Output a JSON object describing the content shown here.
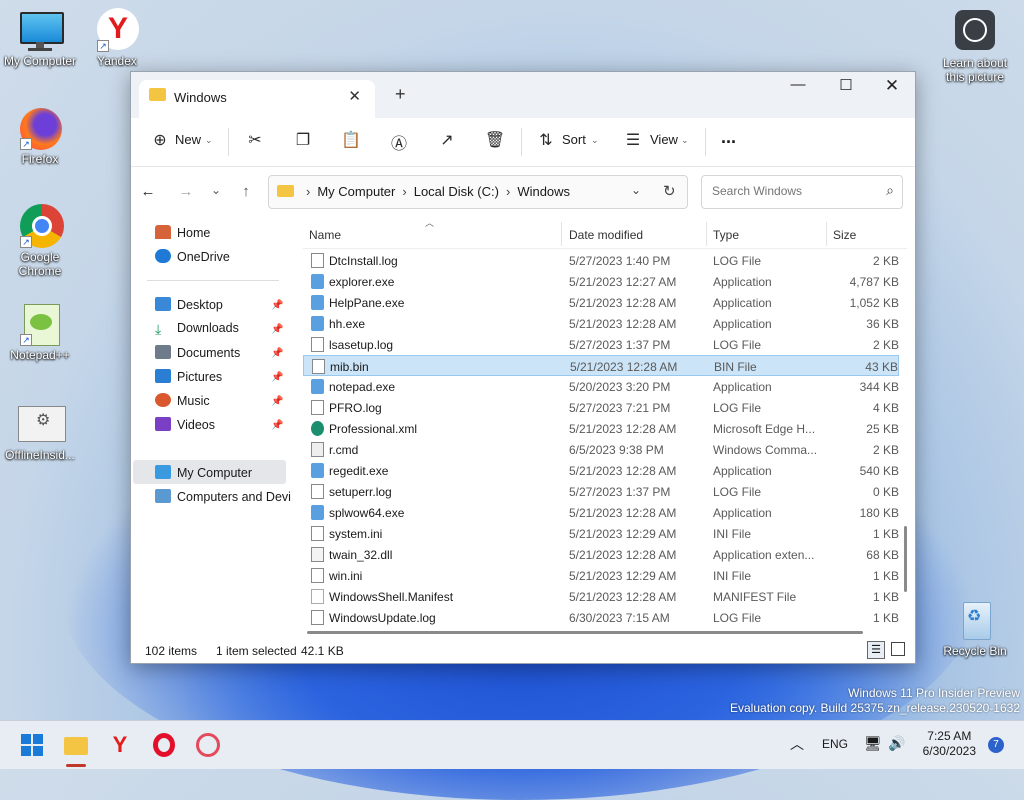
{
  "desktop": {
    "icons": [
      {
        "label": "My Computer"
      },
      {
        "label": "Yandex"
      },
      {
        "label": "Firefox"
      },
      {
        "label": "Google Chrome"
      },
      {
        "label": "Notepad++"
      },
      {
        "label": "OfflineInsid..."
      },
      {
        "label": "Learn about this picture"
      },
      {
        "label": "Recycle Bin"
      }
    ],
    "watermark_line1": "Windows 11 Pro Insider Preview",
    "watermark_line2": "Evaluation copy. Build 25375.zn_release.230520-1632"
  },
  "window": {
    "tab_title": "Windows",
    "toolbar": {
      "new_label": "New",
      "sort_label": "Sort",
      "view_label": "View",
      "more_label": "..."
    },
    "breadcrumb": [
      "My Computer",
      "Local Disk (C:)",
      "Windows"
    ],
    "search_placeholder": "Search Windows",
    "nav": {
      "home": "Home",
      "onedrive": "OneDrive",
      "desktop": "Desktop",
      "downloads": "Downloads",
      "documents": "Documents",
      "pictures": "Pictures",
      "music": "Music",
      "videos": "Videos",
      "mycomputer": "My Computer",
      "computers": "Computers and Devi"
    },
    "columns": {
      "name": "Name",
      "date": "Date modified",
      "type": "Type",
      "size": "Size"
    },
    "files": [
      {
        "name": "DtcInstall.log",
        "date": "5/27/2023 1:40 PM",
        "type": "LOG File",
        "size": "2 KB"
      },
      {
        "name": "explorer.exe",
        "date": "5/21/2023 12:27 AM",
        "type": "Application",
        "size": "4,787 KB"
      },
      {
        "name": "HelpPane.exe",
        "date": "5/21/2023 12:28 AM",
        "type": "Application",
        "size": "1,052 KB"
      },
      {
        "name": "hh.exe",
        "date": "5/21/2023 12:28 AM",
        "type": "Application",
        "size": "36 KB"
      },
      {
        "name": "lsasetup.log",
        "date": "5/27/2023 1:37 PM",
        "type": "LOG File",
        "size": "2 KB"
      },
      {
        "name": "mib.bin",
        "date": "5/21/2023 12:28 AM",
        "type": "BIN File",
        "size": "43 KB"
      },
      {
        "name": "notepad.exe",
        "date": "5/20/2023 3:20 PM",
        "type": "Application",
        "size": "344 KB"
      },
      {
        "name": "PFRO.log",
        "date": "5/27/2023 7:21 PM",
        "type": "LOG File",
        "size": "4 KB"
      },
      {
        "name": "Professional.xml",
        "date": "5/21/2023 12:28 AM",
        "type": "Microsoft Edge H...",
        "size": "25 KB"
      },
      {
        "name": "r.cmd",
        "date": "6/5/2023 9:38 PM",
        "type": "Windows Comma...",
        "size": "2 KB"
      },
      {
        "name": "regedit.exe",
        "date": "5/21/2023 12:28 AM",
        "type": "Application",
        "size": "540 KB"
      },
      {
        "name": "setuperr.log",
        "date": "5/27/2023 1:37 PM",
        "type": "LOG File",
        "size": "0 KB"
      },
      {
        "name": "splwow64.exe",
        "date": "5/21/2023 12:28 AM",
        "type": "Application",
        "size": "180 KB"
      },
      {
        "name": "system.ini",
        "date": "5/21/2023 12:29 AM",
        "type": "INI File",
        "size": "1 KB"
      },
      {
        "name": "twain_32.dll",
        "date": "5/21/2023 12:28 AM",
        "type": "Application exten...",
        "size": "68 KB"
      },
      {
        "name": "win.ini",
        "date": "5/21/2023 12:29 AM",
        "type": "INI File",
        "size": "1 KB"
      },
      {
        "name": "WindowsShell.Manifest",
        "date": "5/21/2023 12:28 AM",
        "type": "MANIFEST File",
        "size": "1 KB"
      },
      {
        "name": "WindowsUpdate.log",
        "date": "6/30/2023 7:15 AM",
        "type": "LOG File",
        "size": "1 KB"
      }
    ],
    "status": {
      "count": "102 items",
      "selected": "1 item selected",
      "size": "42.1 KB"
    }
  },
  "taskbar": {
    "language": "ENG",
    "time": "7:25 AM",
    "date": "6/30/2023",
    "notifications": "7"
  }
}
